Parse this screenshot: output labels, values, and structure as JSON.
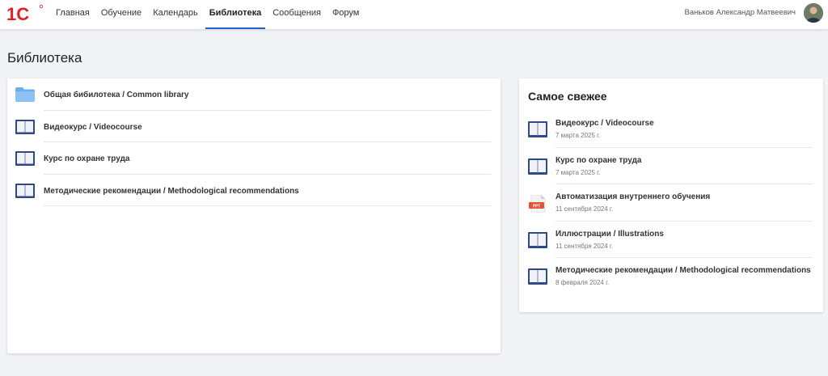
{
  "header": {
    "logo_text": "1С",
    "nav": [
      {
        "label": "Главная",
        "active": false
      },
      {
        "label": "Обучение",
        "active": false
      },
      {
        "label": "Календарь",
        "active": false
      },
      {
        "label": "Библиотека",
        "active": true
      },
      {
        "label": "Сообщения",
        "active": false
      },
      {
        "label": "Форум",
        "active": false
      }
    ],
    "user_name": "Ваньков Александр Матвеевич"
  },
  "page": {
    "title": "Библиотека"
  },
  "library": {
    "items": [
      {
        "label": "Общая бибилотека / Common library",
        "icon": "folder-icon"
      },
      {
        "label": "Видеокурс / Videocourse",
        "icon": "book-icon"
      },
      {
        "label": "Курс по охране труда",
        "icon": "book-icon"
      },
      {
        "label": "Методические рекомендации / Methodological recommendations",
        "icon": "book-icon"
      }
    ]
  },
  "recent": {
    "title": "Самое свежее",
    "items": [
      {
        "title": "Видеокурс / Videocourse",
        "date": "7 марта 2025 г.",
        "icon": "book-icon"
      },
      {
        "title": "Курс по охране труда",
        "date": "7 марта 2025 г.",
        "icon": "book-icon"
      },
      {
        "title": "Автоматизация внутреннего обучения",
        "date": "11 сентября 2024 г.",
        "icon": "ppt-file-icon"
      },
      {
        "title": "Иллюстрации / Illustrations",
        "date": "11 сентября 2024 г.",
        "icon": "book-icon"
      },
      {
        "title": "Методические рекомендации / Methodological recommendations",
        "date": "8 февраля 2024 г.",
        "icon": "book-icon"
      }
    ]
  },
  "colors": {
    "accent": "#1e63c8",
    "logo_red": "#e31e24",
    "folder": "#6aaef0",
    "book": "#2d4a86"
  }
}
